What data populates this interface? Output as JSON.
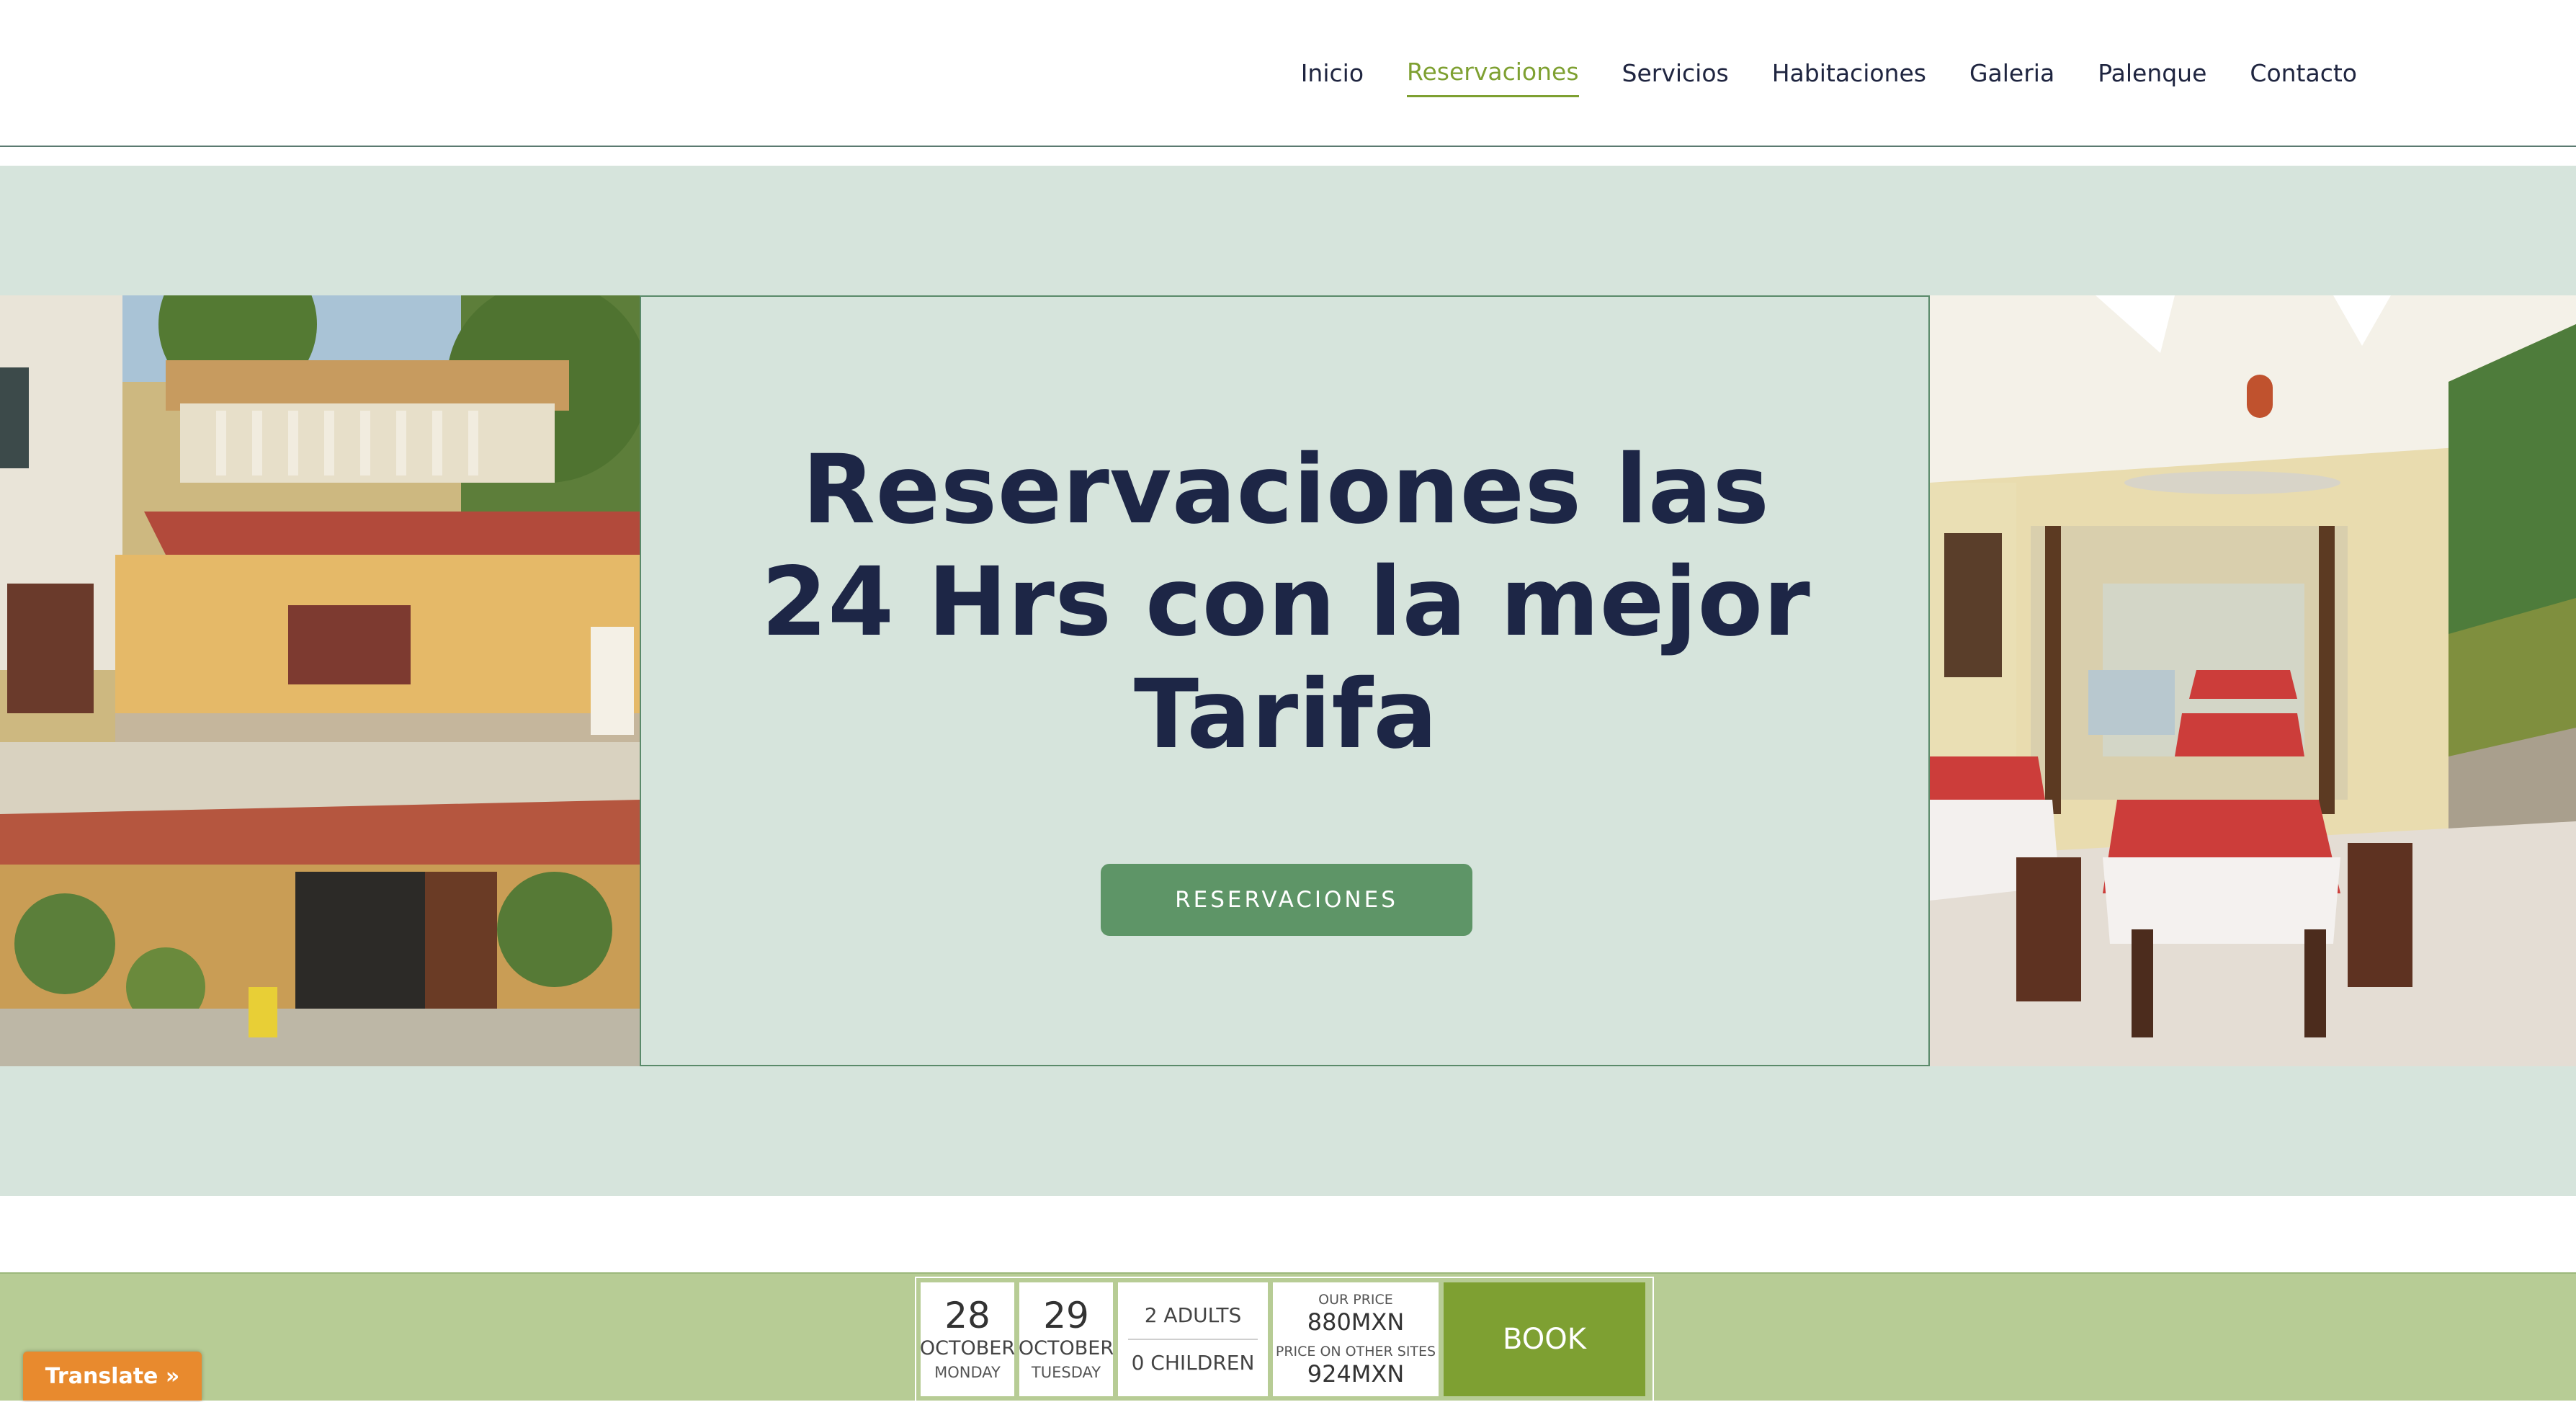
{
  "nav": {
    "items": [
      {
        "label": "Inicio"
      },
      {
        "label": "Reservaciones",
        "active": true
      },
      {
        "label": "Servicios"
      },
      {
        "label": "Habitaciones"
      },
      {
        "label": "Galeria"
      },
      {
        "label": "Palenque"
      },
      {
        "label": "Contacto"
      }
    ],
    "active_color": "#7ea031"
  },
  "hero": {
    "title": "Reservaciones las 24 Hrs con la mejor Tarifa",
    "button_label": "RESERVACIONES",
    "background_color": "#d6e4dc",
    "button_color": "#5e9567"
  },
  "booking": {
    "checkin": {
      "day": "28",
      "month": "OCTOBER",
      "weekday": "MONDAY"
    },
    "checkout": {
      "day": "29",
      "month": "OCTOBER",
      "weekday": "TUESDAY"
    },
    "adults": "2 ADULTS",
    "children": "0 CHILDREN",
    "our_price_label": "OUR PRICE",
    "our_price": "880MXN",
    "other_price_label": "PRICE ON OTHER SITES",
    "other_price": "924MXN",
    "book_label": "BOOK",
    "bar_color": "#b7cc95",
    "book_color": "#7ea032"
  },
  "translate": {
    "label": "Translate »",
    "color": "#e88a2e"
  }
}
